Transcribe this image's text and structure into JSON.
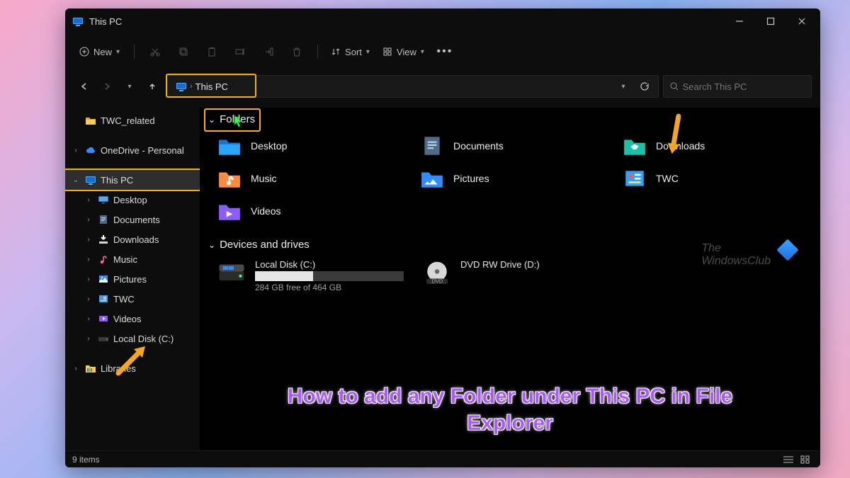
{
  "titlebar": {
    "title": "This PC"
  },
  "toolbar": {
    "new_label": "New",
    "sort_label": "Sort",
    "view_label": "View"
  },
  "address": {
    "crumb": "This PC"
  },
  "search": {
    "placeholder": "Search This PC"
  },
  "sidebar": {
    "items": [
      {
        "label": "TWC_related"
      },
      {
        "label": "OneDrive - Personal"
      },
      {
        "label": "This PC"
      },
      {
        "label": "Desktop"
      },
      {
        "label": "Documents"
      },
      {
        "label": "Downloads"
      },
      {
        "label": "Music"
      },
      {
        "label": "Pictures"
      },
      {
        "label": "TWC"
      },
      {
        "label": "Videos"
      },
      {
        "label": "Local Disk (C:)"
      },
      {
        "label": "Libraries"
      }
    ]
  },
  "sections": {
    "folders_label": "Folders",
    "devices_label": "Devices and drives"
  },
  "folders": [
    {
      "label": "Desktop"
    },
    {
      "label": "Documents"
    },
    {
      "label": "Downloads"
    },
    {
      "label": "Music"
    },
    {
      "label": "Pictures"
    },
    {
      "label": "TWC"
    },
    {
      "label": "Videos"
    }
  ],
  "drives": {
    "local": {
      "name": "Local Disk (C:)",
      "free_text": "284 GB free of 464 GB",
      "used_percent": 39
    },
    "dvd": {
      "name": "DVD RW Drive (D:)"
    }
  },
  "status": {
    "items_text": "9 items"
  },
  "watermark": {
    "line1": "The",
    "line2": "WindowsClub"
  },
  "caption": "How to add any Folder under This PC in File Explorer"
}
